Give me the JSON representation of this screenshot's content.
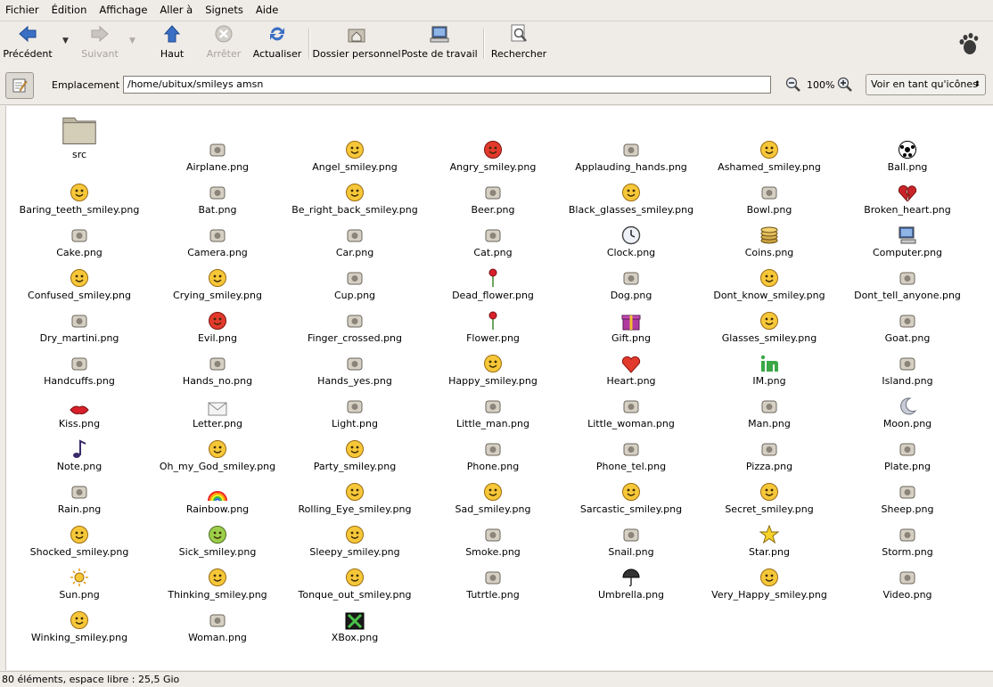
{
  "menu": [
    "Fichier",
    "Édition",
    "Affichage",
    "Aller à",
    "Signets",
    "Aide"
  ],
  "toolbar": {
    "back": "Précédent",
    "forward": "Suivant",
    "up": "Haut",
    "stop": "Arrêter",
    "reload": "Actualiser",
    "home": "Dossier personnel",
    "desktop": "Poste de travail",
    "search": "Rechercher"
  },
  "location": {
    "label": "Emplacement :",
    "value": "/home/ubitux/smileys amsn"
  },
  "zoom": "100%",
  "view_mode": "Voir en tant qu'icônes",
  "files": [
    "src",
    "Airplane.png",
    "Angel_smiley.png",
    "Angry_smiley.png",
    "Applauding_hands.png",
    "Ashamed_smiley.png",
    "Ball.png",
    "Baring_teeth_smiley.png",
    "Bat.png",
    "Be_right_back_smiley.png",
    "Beer.png",
    "Black_glasses_smiley.png",
    "Bowl.png",
    "Broken_heart.png",
    "Cake.png",
    "Camera.png",
    "Car.png",
    "Cat.png",
    "Clock.png",
    "Coins.png",
    "Computer.png",
    "Confused_smiley.png",
    "Crying_smiley.png",
    "Cup.png",
    "Dead_flower.png",
    "Dog.png",
    "Dont_know_smiley.png",
    "Dont_tell_anyone.png",
    "Dry_martini.png",
    "Evil.png",
    "Finger_crossed.png",
    "Flower.png",
    "Gift.png",
    "Glasses_smiley.png",
    "Goat.png",
    "Handcuffs.png",
    "Hands_no.png",
    "Hands_yes.png",
    "Happy_smiley.png",
    "Heart.png",
    "IM.png",
    "Island.png",
    "Kiss.png",
    "Letter.png",
    "Light.png",
    "Little_man.png",
    "Little_woman.png",
    "Man.png",
    "Moon.png",
    "Note.png",
    "Oh_my_God_smiley.png",
    "Party_smiley.png",
    "Phone.png",
    "Phone_tel.png",
    "Pizza.png",
    "Plate.png",
    "Rain.png",
    "Rainbow.png",
    "Rolling_Eye_smiley.png",
    "Sad_smiley.png",
    "Sarcastic_smiley.png",
    "Secret_smiley.png",
    "Sheep.png",
    "Shocked_smiley.png",
    "Sick_smiley.png",
    "Sleepy_smiley.png",
    "Smoke.png",
    "Snail.png",
    "Star.png",
    "Storm.png",
    "Sun.png",
    "Thinking_smiley.png",
    "Tonque_out_smiley.png",
    "Tutrtle.png",
    "Umbrella.png",
    "Very_Happy_smiley.png",
    "Video.png",
    "Winking_smiley.png",
    "Woman.png",
    "XBox.png"
  ],
  "status": "80 éléments, espace libre : 25,5 Gio"
}
